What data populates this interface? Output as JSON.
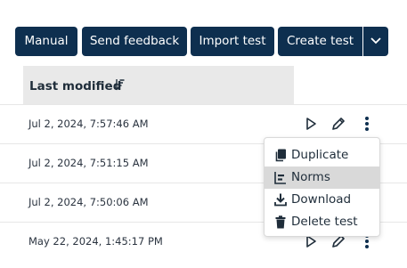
{
  "toolbar": {
    "manual_label": "Manual",
    "feedback_label": "Send feedback",
    "import_label": "Import test",
    "create_label": "Create test"
  },
  "table": {
    "column_header": "Last modified",
    "rows": [
      {
        "date": "Jul 2, 2024, 7:57:46 AM"
      },
      {
        "date": "Jul 2, 2024, 7:51:15 AM"
      },
      {
        "date": "Jul 2, 2024, 7:50:06 AM"
      },
      {
        "date": "May 22, 2024, 1:45:17 PM"
      }
    ]
  },
  "menu": {
    "items": [
      {
        "label": "Duplicate",
        "icon": "duplicate-icon"
      },
      {
        "label": "Norms",
        "icon": "norms-icon",
        "highlighted": true
      },
      {
        "label": "Download",
        "icon": "download-icon"
      },
      {
        "label": "Delete test",
        "icon": "trash-icon"
      }
    ]
  },
  "colors": {
    "primary": "#0e2f4f",
    "header_bg": "#e9e9e9",
    "highlight_bg": "#d9d9d9"
  }
}
